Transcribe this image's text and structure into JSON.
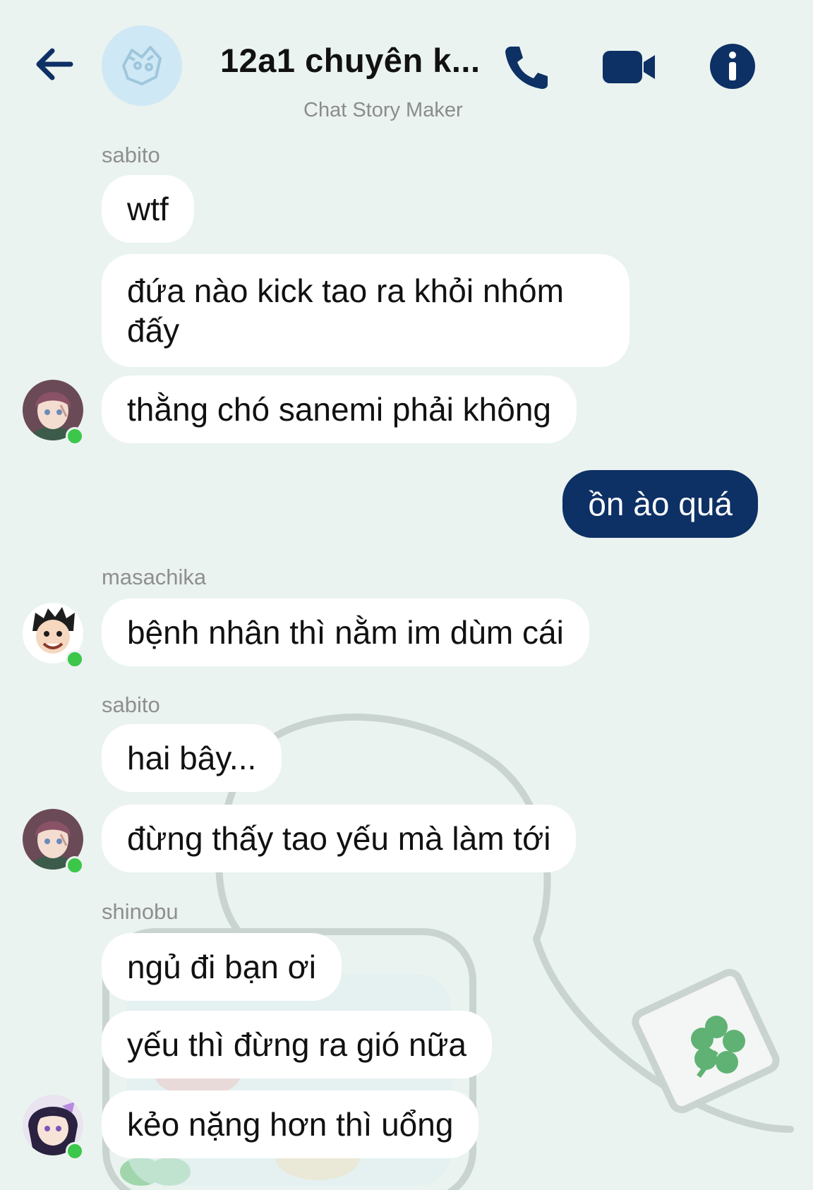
{
  "header": {
    "title": "12a1 chuyên k...",
    "subtitle": "Chat Story Maker"
  },
  "icons": {
    "back": "arrow-left-icon",
    "call": "phone-icon",
    "video": "video-camera-icon",
    "info": "info-icon"
  },
  "colors": {
    "background": "#eaf3ef",
    "accent": "#0d3065",
    "bubble": "#ffffff",
    "online": "#3cc64a"
  },
  "messages": [
    {
      "sender": "sabito",
      "texts": [
        "wtf",
        "đứa nào kick tao ra khỏi nhóm đấy",
        "thằng chó sanemi phải không"
      ]
    },
    {
      "sender": "me",
      "texts": [
        "ồn ào quá"
      ]
    },
    {
      "sender": "masachika",
      "texts": [
        "bệnh nhân thì nằm im dùm cái"
      ]
    },
    {
      "sender": "sabito",
      "texts": [
        "hai bây...",
        "đừng thấy tao yếu mà làm tới"
      ]
    },
    {
      "sender": "shinobu",
      "texts": [
        "ngủ đi bạn ơi",
        "yếu thì đừng ra gió nữa",
        "kẻo nặng hơn thì uổng"
      ]
    }
  ]
}
